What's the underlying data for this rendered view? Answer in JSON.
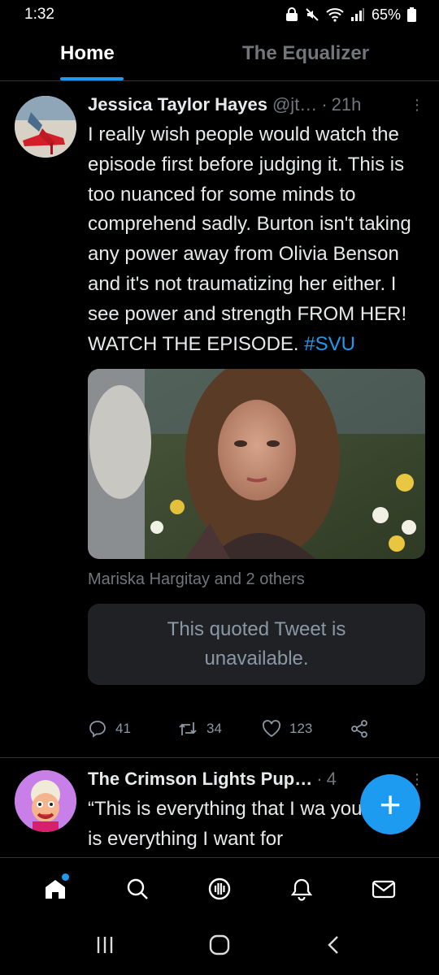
{
  "status_bar": {
    "time": "1:32",
    "battery": "65%"
  },
  "tabs": [
    {
      "label": "Home",
      "active": true
    },
    {
      "label": "The Equalizer",
      "active": false
    }
  ],
  "tweet1": {
    "author": "Jessica Taylor Hayes",
    "handle": "@jt…",
    "dot": "·",
    "time": "21h",
    "text": "I really wish people would watch the episode first before judging it. This is too nuanced for some minds to comprehend sadly. Burton isn't taking any power away from Olivia Benson and it's not traumatizing her either. I see power and strength FROM HER! WATCH THE EPISODE. ",
    "hashtag": "#SVU",
    "media_caption": "Mariska Hargitay and 2 others",
    "quote_unavailable": "This quoted Tweet is unavailable.",
    "actions": {
      "replies": "41",
      "retweets": "34",
      "likes": "123"
    }
  },
  "tweet2": {
    "author": "The Crimson Lights Pup…",
    "dot": "·",
    "time": "4",
    "text": "“This is everything that I wa you. This is everything I want for"
  },
  "fab_label": "+",
  "colors": {
    "accent": "#1d9bf0",
    "background": "#000000",
    "muted": "#71767b"
  },
  "icons": {
    "reply": "reply-icon",
    "retweet": "retweet-icon",
    "like": "heart-icon",
    "share": "share-icon",
    "home": "home-icon",
    "search": "search-icon",
    "spaces": "spaces-icon",
    "notifications": "bell-icon",
    "messages": "mail-icon"
  }
}
